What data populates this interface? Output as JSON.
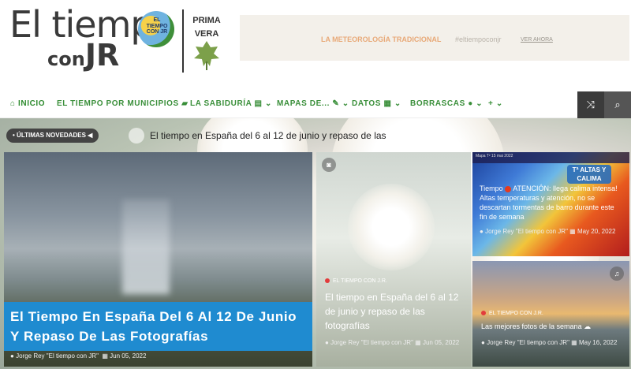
{
  "logo": {
    "line1": "El tiempo",
    "line2_small": "con",
    "line2_big": "JR",
    "circle_text": "EL TIEMPO CON JR",
    "season_line1": "PRIMA",
    "season_line2": "VERA"
  },
  "banner": {
    "title": "LA METEOROLOGÍA TRADICIONAL",
    "hashtag": "#eltiempoconjr",
    "link": "VER AHORA"
  },
  "nav": {
    "home": "INICIO",
    "items": [
      "EL TIEMPO POR MUNICIPIOS",
      "LA SABIDURÍA",
      "MAPAS DE...",
      "DATOS",
      "BORRASCAS",
      "+"
    ],
    "colors": {
      "accent": "#3a8f3a"
    }
  },
  "ticker": {
    "label": "ÚLTIMAS NOVEDADES",
    "text": "El tiempo en España del 6 al 12 de junio y repaso de las"
  },
  "cards": [
    {
      "title": "El Tiempo En España Del 6 Al 12 De Junio Y Repaso De Las Fotografías",
      "author": "Jorge Rey \"El tiempo con JR\"",
      "date": "Jun 05, 2022"
    },
    {
      "category": "EL TIEMPO CON J.R.",
      "title": "El tiempo en España del 6 al 12 de junio y repaso de las fotografías",
      "author": "Jorge Rey \"El tiempo con JR\"",
      "date": "Jun 05, 2022"
    },
    {
      "map_header": "Mapa T² 15 mai 2022",
      "badge": "Tª ALTAS Y CALIMA",
      "text_pre": "Tiempo",
      "text_post": "ATENCIÓN: llega calima intensa! Altas temperaturas y atención, no se descartan tormentas de barro durante este fin de semana",
      "author": "Jorge Rey \"El tiempo con JR\"",
      "date": "May 20, 2022"
    },
    {
      "category": "EL TIEMPO CON J.R.",
      "title": "Las mejores fotos de la semana",
      "author": "Jorge Rey \"El tiempo con JR\"",
      "date": "May 16, 2022"
    }
  ]
}
